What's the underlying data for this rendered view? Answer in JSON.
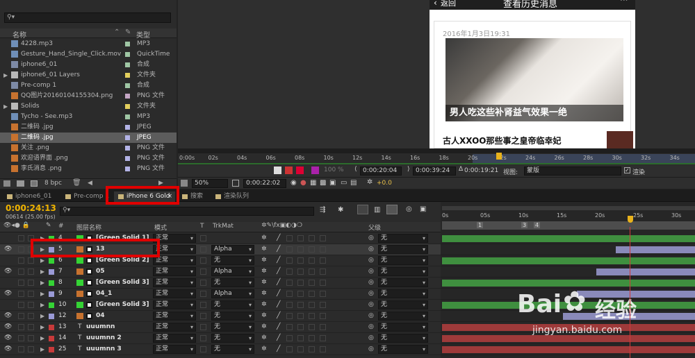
{
  "project": {
    "search_placeholder": "",
    "col_name": "名称",
    "col_type": "类型",
    "items": [
      {
        "name": "4228.mp3",
        "type": "MP3",
        "swatch": "#9fc6a4",
        "icon": "audio-file-icon",
        "selected": false
      },
      {
        "name": "Gesture_Hand_Single_Click.mov",
        "type": "QuickTime",
        "swatch": "#9fc6a4",
        "icon": "video-file-icon",
        "selected": false
      },
      {
        "name": "iphone6_01",
        "type": "合成",
        "swatch": "#9fc6a4",
        "icon": "composition-icon",
        "selected": false
      },
      {
        "name": "iphone6_01 Layers",
        "type": "文件夹",
        "swatch": "#e3cf5d",
        "icon": "folder-icon",
        "selected": false
      },
      {
        "name": "Pre-comp 1",
        "type": "合成",
        "swatch": "#9fc6a4",
        "icon": "composition-icon",
        "selected": false
      },
      {
        "name": "QQ图片20160104155304.png",
        "type": "PNG 文件",
        "swatch": "#c4a6c4",
        "icon": "image-file-icon",
        "selected": false
      },
      {
        "name": "Solids",
        "type": "文件夹",
        "swatch": "#e3cf5d",
        "icon": "folder-icon",
        "selected": false
      },
      {
        "name": "Tycho - See.mp3",
        "type": "MP3",
        "swatch": "#9fc6a4",
        "icon": "audio-file-icon",
        "selected": false
      },
      {
        "name": "二维码 .jpg",
        "type": "JPEG",
        "swatch": "#b3b3e6",
        "icon": "image-file-icon",
        "selected": false
      },
      {
        "name": "二维码 .jpg",
        "type": "JPEG",
        "swatch": "#b3b3e6",
        "icon": "image-file-icon",
        "selected": true
      },
      {
        "name": "关注 .png",
        "type": "PNG 文件",
        "swatch": "#b3b3e6",
        "icon": "image-file-icon",
        "selected": false
      },
      {
        "name": "欢迎语界面 .png",
        "type": "PNG 文件",
        "swatch": "#b3b3e6",
        "icon": "image-file-icon",
        "selected": false
      },
      {
        "name": "李氏消息 .png",
        "type": "PNG 文件",
        "swatch": "#b3b3e6",
        "icon": "image-file-icon",
        "selected": false
      }
    ],
    "bpc_label": "8 bpc"
  },
  "viewer": {
    "phone_back": "返回",
    "phone_title": "查看历史消息",
    "article_date": "2016年1月3日19:31",
    "article_caption": "男人吃这些补肾益气效果一绝",
    "article2_title": "古人XXOO那些事之皇帝临幸妃",
    "ruler_ticks": [
      "0:00s",
      "02s",
      "04s",
      "06s",
      "08s",
      "10s",
      "12s",
      "14s",
      "16s",
      "18s",
      "20s",
      "22s",
      "24s",
      "26s",
      "28s",
      "30s",
      "32s",
      "34s"
    ],
    "percent": "100 %",
    "time_in": "0:00:20:04",
    "time_out": "0:00:39:24",
    "time_dur": "0:00:19:21",
    "view_label": "视图:",
    "view_value": "蒙版",
    "render_label": "渲染",
    "zoom": "50%",
    "current_time": "0:00:22:02",
    "exposure": "+0.0"
  },
  "tabs": [
    {
      "label": "iphone6_01",
      "active": false
    },
    {
      "label": "Pre-comp 1",
      "active": false
    },
    {
      "label": "iPhone 6 Gold",
      "active": true
    },
    {
      "label": "搜索",
      "active": false
    },
    {
      "label": "渲染队列",
      "active": false
    }
  ],
  "timeline": {
    "timecode": "0:00:24:13",
    "frames": "00614 (25.00 fps)",
    "headers": {
      "layer_name": "图层名称",
      "mode": "模式",
      "trkmat": "TrkMat",
      "parent": "父级"
    },
    "ruler_ticks": [
      "0s",
      "05s",
      "10s",
      "15s",
      "20s",
      "25s",
      "30s"
    ],
    "markers": [
      "1",
      "3",
      "4"
    ],
    "layers": [
      {
        "num": "4",
        "name": "[Green Solid 1]",
        "color": "#35d335",
        "mode": "正常",
        "trkmat": "",
        "parent": "无",
        "eye": false
      },
      {
        "num": "5",
        "name": "13",
        "color": "#9a9ad6",
        "mode": "正常",
        "trkmat": "Alpha",
        "parent": "无",
        "eye": true
      },
      {
        "num": "6",
        "name": "[Green Solid 2]",
        "color": "#35d335",
        "mode": "正常",
        "trkmat": "无",
        "parent": "无",
        "eye": false
      },
      {
        "num": "7",
        "name": "05",
        "color": "#9a9ad6",
        "mode": "正常",
        "trkmat": "Alpha",
        "parent": "无",
        "eye": true
      },
      {
        "num": "8",
        "name": "[Green Solid 3]",
        "color": "#35d335",
        "mode": "正常",
        "trkmat": "无",
        "parent": "无",
        "eye": false
      },
      {
        "num": "9",
        "name": "04_1",
        "color": "#9a9ad6",
        "mode": "正常",
        "trkmat": "Alpha",
        "parent": "无",
        "eye": true
      },
      {
        "num": "10",
        "name": "[Green Solid 3]",
        "color": "#35d335",
        "mode": "正常",
        "trkmat": "无",
        "parent": "无",
        "eye": false
      },
      {
        "num": "12",
        "name": "04",
        "color": "#9a9ad6",
        "mode": "正常",
        "trkmat": "无",
        "parent": "无",
        "eye": true
      },
      {
        "num": "13",
        "name": "uuumnn",
        "color": "#c83a3a",
        "mode": "正常",
        "trkmat": "无",
        "parent": "无",
        "eye": true
      },
      {
        "num": "14",
        "name": "uuumnn 2",
        "color": "#c83a3a",
        "mode": "正常",
        "trkmat": "无",
        "parent": "无",
        "eye": true
      },
      {
        "num": "25",
        "name": "uuumnn 3",
        "color": "#c83a3a",
        "mode": "正常",
        "trkmat": "无",
        "parent": "无",
        "eye": true
      }
    ]
  },
  "watermark": {
    "brand": "Bai",
    "brand2": "经验",
    "url": "jingyan.baidu.com"
  }
}
